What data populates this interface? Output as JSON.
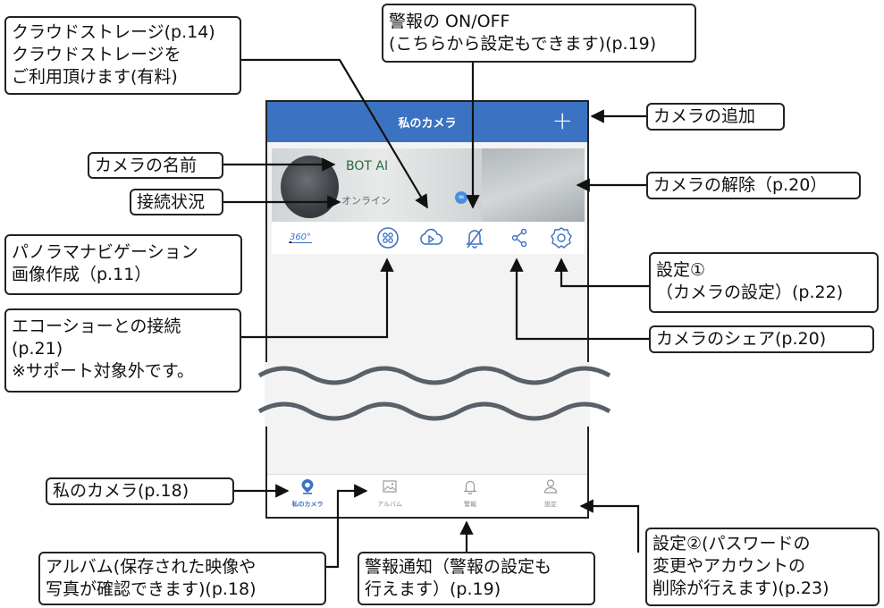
{
  "phone": {
    "title": "私のカメラ",
    "add_glyph": "+",
    "camera": {
      "name": "BOT AI",
      "status": "オンライン"
    },
    "toolbar": {
      "pano_label": "360°"
    },
    "tabs": [
      {
        "label": "私のカメラ",
        "active": true,
        "icon": "camera-location-icon"
      },
      {
        "label": "アルバム",
        "active": false,
        "icon": "picture-icon"
      },
      {
        "label": "警報",
        "active": false,
        "icon": "bell-icon"
      },
      {
        "label": "設定",
        "active": false,
        "icon": "user-icon"
      }
    ],
    "accent": "#3c72c2"
  },
  "callouts": {
    "cloud": [
      "クラウドストレージ(p.14)",
      "クラウドストレージを",
      "ご利用頂けます(有料)"
    ],
    "alarm_toggle": [
      "警報の ON/OFF",
      "(こちらから設定もできます)(p.19)"
    ],
    "camera_name": "カメラの名前",
    "status": "接続状況",
    "panorama": [
      "パノラマナビゲーション",
      "画像作成（p.11）"
    ],
    "echo": [
      "エコーショーとの接続",
      "(p.21)",
      "※サポート対象外です。"
    ],
    "add_camera": "カメラの追加",
    "remove_camera": "カメラの解除（p.20）",
    "settings1": [
      "設定①",
      "（カメラの設定）(p.22)"
    ],
    "share": "カメラのシェア(p.20)",
    "my_camera": "私のカメラ(p.18)",
    "album": [
      "アルバム(保存された映像や",
      "写真が確認できます)(p.18)"
    ],
    "alarm_notice": [
      "警報通知（警報の設定も",
      "行えます）(p.19)"
    ],
    "settings2": [
      "設定②(パスワードの",
      "変更やアカウントの",
      "削除が行えます)(p.23)"
    ]
  }
}
